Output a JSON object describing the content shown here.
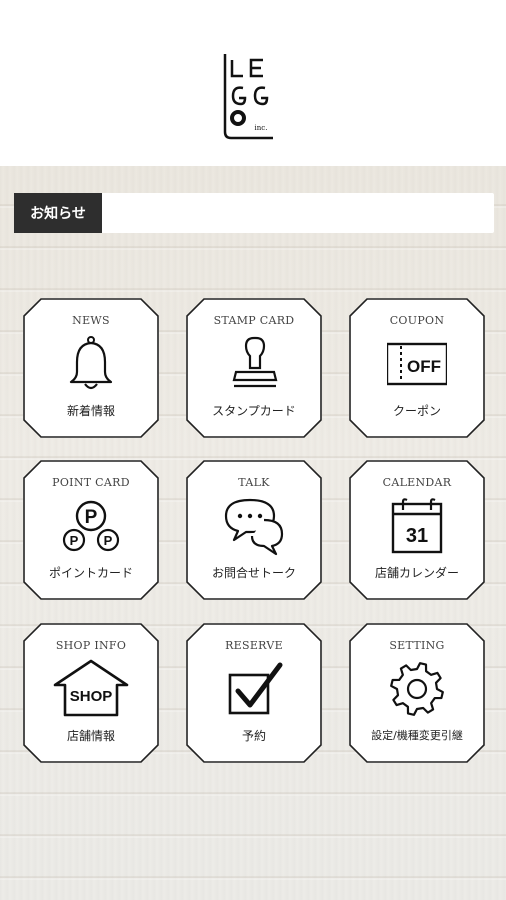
{
  "logo": {
    "text": "LEGGO inc."
  },
  "notice": {
    "label": "お知らせ",
    "content": ""
  },
  "tiles": [
    {
      "title": "NEWS",
      "label": "新着情報",
      "icon": "bell-icon"
    },
    {
      "title": "STAMP CARD",
      "label": "スタンプカード",
      "icon": "stamp-icon"
    },
    {
      "title": "COUPON",
      "label": "クーポン",
      "icon": "coupon-icon",
      "icon_text": "OFF"
    },
    {
      "title": "POINT CARD",
      "label": "ポイントカード",
      "icon": "points-icon",
      "icon_text": "P"
    },
    {
      "title": "TALK",
      "label": "お問合せトーク",
      "icon": "chat-bubbles-icon"
    },
    {
      "title": "CALENDAR",
      "label": "店舗カレンダー",
      "icon": "calendar-icon",
      "icon_text": "31"
    },
    {
      "title": "SHOP INFO",
      "label": "店舗情報",
      "icon": "shop-icon",
      "icon_text": "SHOP"
    },
    {
      "title": "RESERVE",
      "label": "予約",
      "icon": "checkbox-icon"
    },
    {
      "title": "SETTING",
      "label": "設定/機種変更引継",
      "icon": "gear-icon"
    }
  ]
}
